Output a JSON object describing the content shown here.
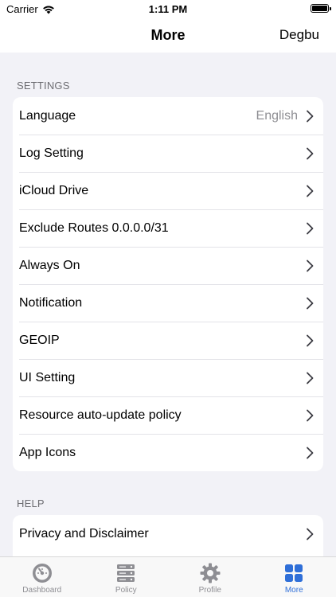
{
  "status_bar": {
    "carrier": "Carrier",
    "time": "1:11 PM"
  },
  "nav": {
    "title": "More",
    "right_button": "Degbu"
  },
  "sections": [
    {
      "header": "SETTINGS",
      "items": [
        {
          "label": "Language",
          "value": "English"
        },
        {
          "label": "Log Setting"
        },
        {
          "label": "iCloud Drive"
        },
        {
          "label": "Exclude Routes 0.0.0.0/31"
        },
        {
          "label": "Always On"
        },
        {
          "label": "Notification"
        },
        {
          "label": "GEOIP"
        },
        {
          "label": "UI Setting"
        },
        {
          "label": "Resource auto-update policy"
        },
        {
          "label": "App Icons"
        }
      ]
    },
    {
      "header": "HELP",
      "items": [
        {
          "label": "Privacy and Disclaimer"
        }
      ]
    }
  ],
  "tabs": [
    {
      "label": "Dashboard",
      "icon": "dashboard-icon"
    },
    {
      "label": "Policy",
      "icon": "server-icon"
    },
    {
      "label": "Profile",
      "icon": "gear-icon"
    },
    {
      "label": "More",
      "icon": "grid-icon",
      "active": true
    }
  ],
  "colors": {
    "background": "#f2f2f7",
    "accent": "#2f6fd8",
    "inactive": "#8e8e93"
  }
}
